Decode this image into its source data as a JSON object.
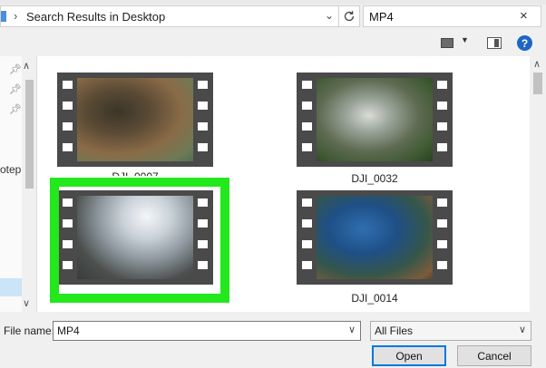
{
  "address": {
    "breadcrumb": "Search Results in Desktop",
    "chevron": "›",
    "dropdown_glyph": "⌄",
    "refresh_icon": "refresh-icon"
  },
  "search": {
    "value": "MP4",
    "clear_glyph": "×"
  },
  "toolbar": {
    "help_glyph": "?"
  },
  "nav": {
    "partial_label": "otep"
  },
  "files": [
    {
      "name": "DJI_0007",
      "selected": false
    },
    {
      "name": "DJI_0032",
      "selected": false
    },
    {
      "name": "",
      "selected": true
    },
    {
      "name": "DJI_0014",
      "selected": false
    }
  ],
  "bottom": {
    "file_name_label": "File name:",
    "file_name_value": "MP4",
    "file_type_value": "All Files",
    "open_label": "Open",
    "cancel_label": "Cancel"
  },
  "colors": {
    "selection_highlight": "#22e81c",
    "accent": "#0078d7"
  }
}
